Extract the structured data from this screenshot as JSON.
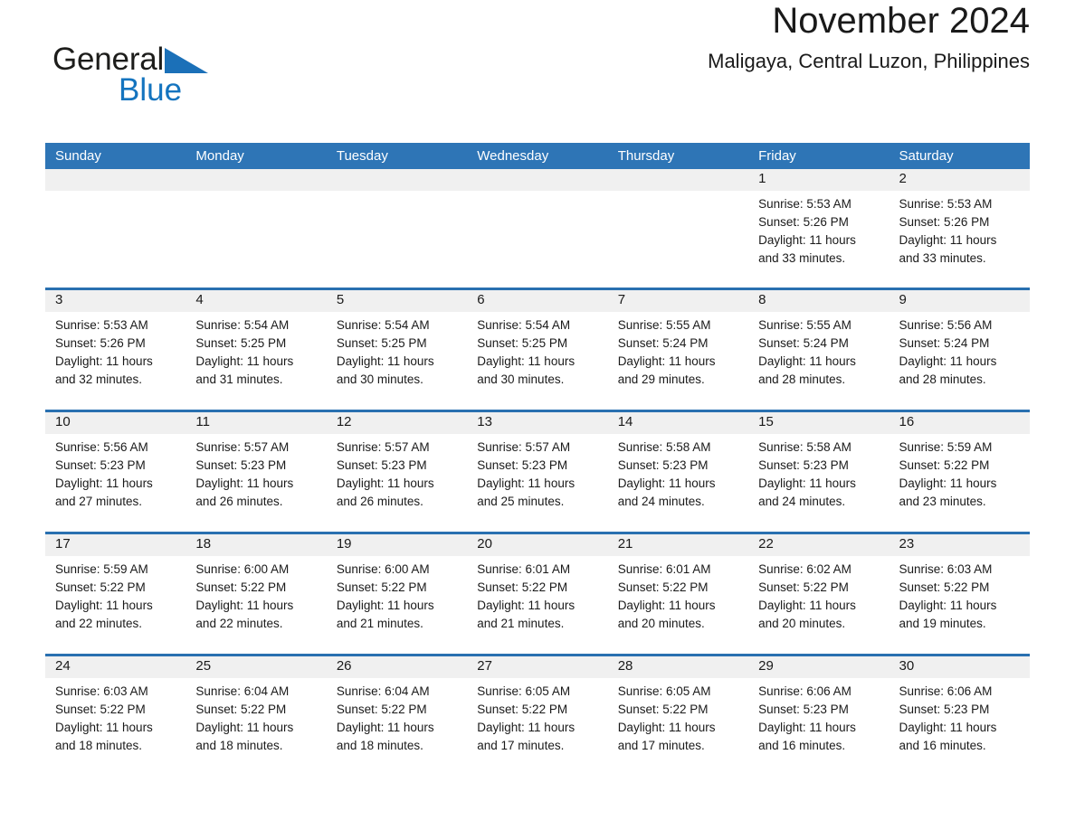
{
  "brand": {
    "name_part1": "General",
    "name_part2": "Blue",
    "triangle_icon": "blue-triangle-icon",
    "colors": {
      "text": "#1d1d1b",
      "accent": "#1474bf"
    }
  },
  "header": {
    "month_title": "November 2024",
    "location": "Maligaya, Central Luzon, Philippines"
  },
  "theme": {
    "header_blue": "#2e75b6",
    "separator_blue": "#2970b0",
    "band_gray": "#f0f0f0",
    "text": "#1a1a1a"
  },
  "calendar": {
    "weekdays": [
      "Sunday",
      "Monday",
      "Tuesday",
      "Wednesday",
      "Thursday",
      "Friday",
      "Saturday"
    ],
    "weeks": [
      [
        {
          "day": "",
          "info": ""
        },
        {
          "day": "",
          "info": ""
        },
        {
          "day": "",
          "info": ""
        },
        {
          "day": "",
          "info": ""
        },
        {
          "day": "",
          "info": ""
        },
        {
          "day": "1",
          "info": "Sunrise: 5:53 AM\nSunset: 5:26 PM\nDaylight: 11 hours\nand 33 minutes."
        },
        {
          "day": "2",
          "info": "Sunrise: 5:53 AM\nSunset: 5:26 PM\nDaylight: 11 hours\nand 33 minutes."
        }
      ],
      [
        {
          "day": "3",
          "info": "Sunrise: 5:53 AM\nSunset: 5:26 PM\nDaylight: 11 hours\nand 32 minutes."
        },
        {
          "day": "4",
          "info": "Sunrise: 5:54 AM\nSunset: 5:25 PM\nDaylight: 11 hours\nand 31 minutes."
        },
        {
          "day": "5",
          "info": "Sunrise: 5:54 AM\nSunset: 5:25 PM\nDaylight: 11 hours\nand 30 minutes."
        },
        {
          "day": "6",
          "info": "Sunrise: 5:54 AM\nSunset: 5:25 PM\nDaylight: 11 hours\nand 30 minutes."
        },
        {
          "day": "7",
          "info": "Sunrise: 5:55 AM\nSunset: 5:24 PM\nDaylight: 11 hours\nand 29 minutes."
        },
        {
          "day": "8",
          "info": "Sunrise: 5:55 AM\nSunset: 5:24 PM\nDaylight: 11 hours\nand 28 minutes."
        },
        {
          "day": "9",
          "info": "Sunrise: 5:56 AM\nSunset: 5:24 PM\nDaylight: 11 hours\nand 28 minutes."
        }
      ],
      [
        {
          "day": "10",
          "info": "Sunrise: 5:56 AM\nSunset: 5:23 PM\nDaylight: 11 hours\nand 27 minutes."
        },
        {
          "day": "11",
          "info": "Sunrise: 5:57 AM\nSunset: 5:23 PM\nDaylight: 11 hours\nand 26 minutes."
        },
        {
          "day": "12",
          "info": "Sunrise: 5:57 AM\nSunset: 5:23 PM\nDaylight: 11 hours\nand 26 minutes."
        },
        {
          "day": "13",
          "info": "Sunrise: 5:57 AM\nSunset: 5:23 PM\nDaylight: 11 hours\nand 25 minutes."
        },
        {
          "day": "14",
          "info": "Sunrise: 5:58 AM\nSunset: 5:23 PM\nDaylight: 11 hours\nand 24 minutes."
        },
        {
          "day": "15",
          "info": "Sunrise: 5:58 AM\nSunset: 5:23 PM\nDaylight: 11 hours\nand 24 minutes."
        },
        {
          "day": "16",
          "info": "Sunrise: 5:59 AM\nSunset: 5:22 PM\nDaylight: 11 hours\nand 23 minutes."
        }
      ],
      [
        {
          "day": "17",
          "info": "Sunrise: 5:59 AM\nSunset: 5:22 PM\nDaylight: 11 hours\nand 22 minutes."
        },
        {
          "day": "18",
          "info": "Sunrise: 6:00 AM\nSunset: 5:22 PM\nDaylight: 11 hours\nand 22 minutes."
        },
        {
          "day": "19",
          "info": "Sunrise: 6:00 AM\nSunset: 5:22 PM\nDaylight: 11 hours\nand 21 minutes."
        },
        {
          "day": "20",
          "info": "Sunrise: 6:01 AM\nSunset: 5:22 PM\nDaylight: 11 hours\nand 21 minutes."
        },
        {
          "day": "21",
          "info": "Sunrise: 6:01 AM\nSunset: 5:22 PM\nDaylight: 11 hours\nand 20 minutes."
        },
        {
          "day": "22",
          "info": "Sunrise: 6:02 AM\nSunset: 5:22 PM\nDaylight: 11 hours\nand 20 minutes."
        },
        {
          "day": "23",
          "info": "Sunrise: 6:03 AM\nSunset: 5:22 PM\nDaylight: 11 hours\nand 19 minutes."
        }
      ],
      [
        {
          "day": "24",
          "info": "Sunrise: 6:03 AM\nSunset: 5:22 PM\nDaylight: 11 hours\nand 18 minutes."
        },
        {
          "day": "25",
          "info": "Sunrise: 6:04 AM\nSunset: 5:22 PM\nDaylight: 11 hours\nand 18 minutes."
        },
        {
          "day": "26",
          "info": "Sunrise: 6:04 AM\nSunset: 5:22 PM\nDaylight: 11 hours\nand 18 minutes."
        },
        {
          "day": "27",
          "info": "Sunrise: 6:05 AM\nSunset: 5:22 PM\nDaylight: 11 hours\nand 17 minutes."
        },
        {
          "day": "28",
          "info": "Sunrise: 6:05 AM\nSunset: 5:22 PM\nDaylight: 11 hours\nand 17 minutes."
        },
        {
          "day": "29",
          "info": "Sunrise: 6:06 AM\nSunset: 5:23 PM\nDaylight: 11 hours\nand 16 minutes."
        },
        {
          "day": "30",
          "info": "Sunrise: 6:06 AM\nSunset: 5:23 PM\nDaylight: 11 hours\nand 16 minutes."
        }
      ]
    ]
  }
}
